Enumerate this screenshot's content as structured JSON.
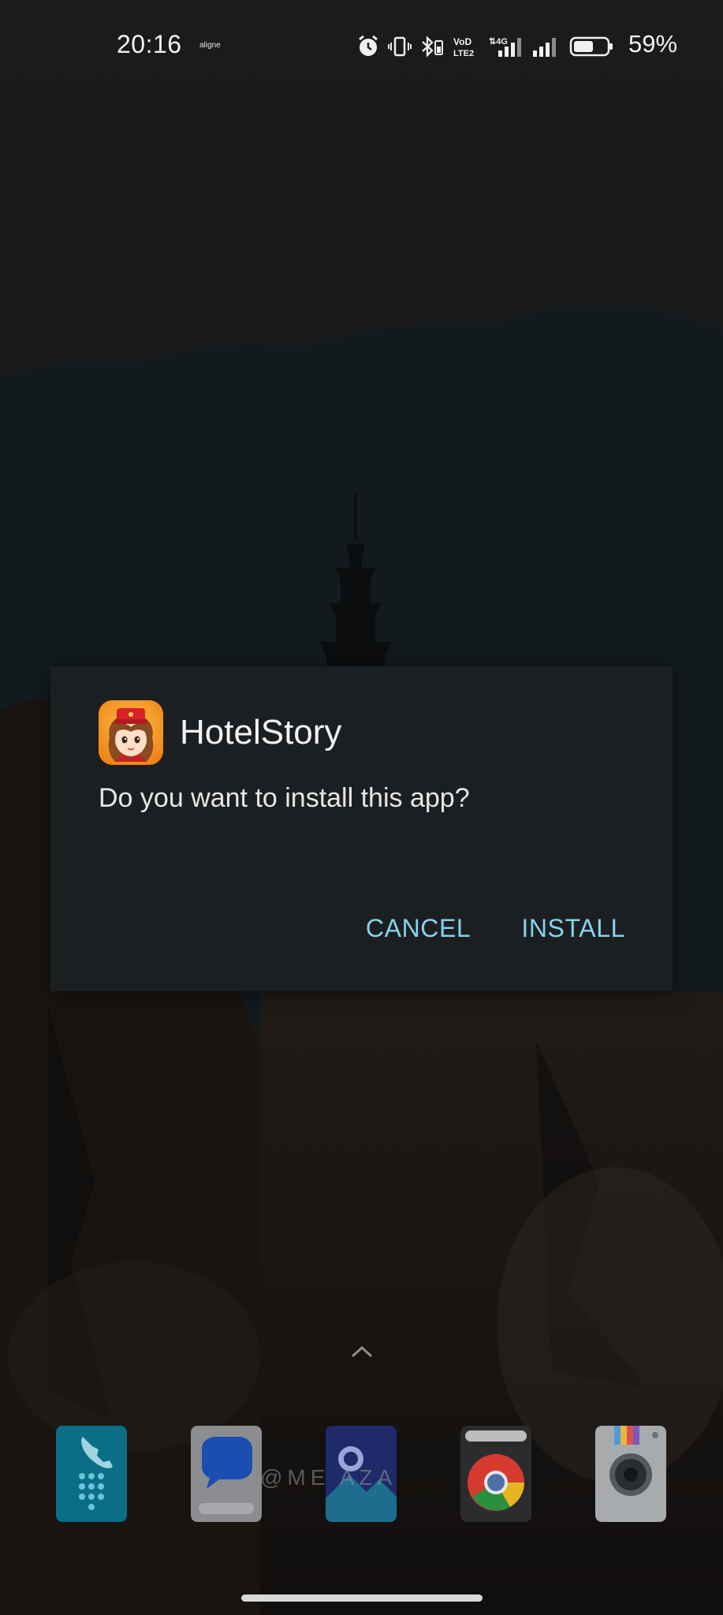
{
  "status_bar": {
    "time": "20:16",
    "carrier_label": "aligne",
    "battery_percent": "59%",
    "battery_level": 0.59,
    "icons": [
      "alarm-icon",
      "vibrate-icon",
      "bluetooth-icon",
      "volte-icon",
      "4g-signal-icon",
      "signal-strength-icon",
      "battery-icon"
    ],
    "volte_label": "VoLTE2",
    "network_label": "4G"
  },
  "dialog": {
    "app_name": "HotelStory",
    "message": "Do you want to install this app?",
    "cancel_label": "CANCEL",
    "install_label": "INSTALL",
    "accent_color": "#86d2ec",
    "background_color": "#1c1f21"
  },
  "home": {
    "watermark_text": "@ME    AZA",
    "dock_apps": [
      "Phone",
      "Messages",
      "Gallery",
      "Chrome",
      "Camera"
    ]
  }
}
